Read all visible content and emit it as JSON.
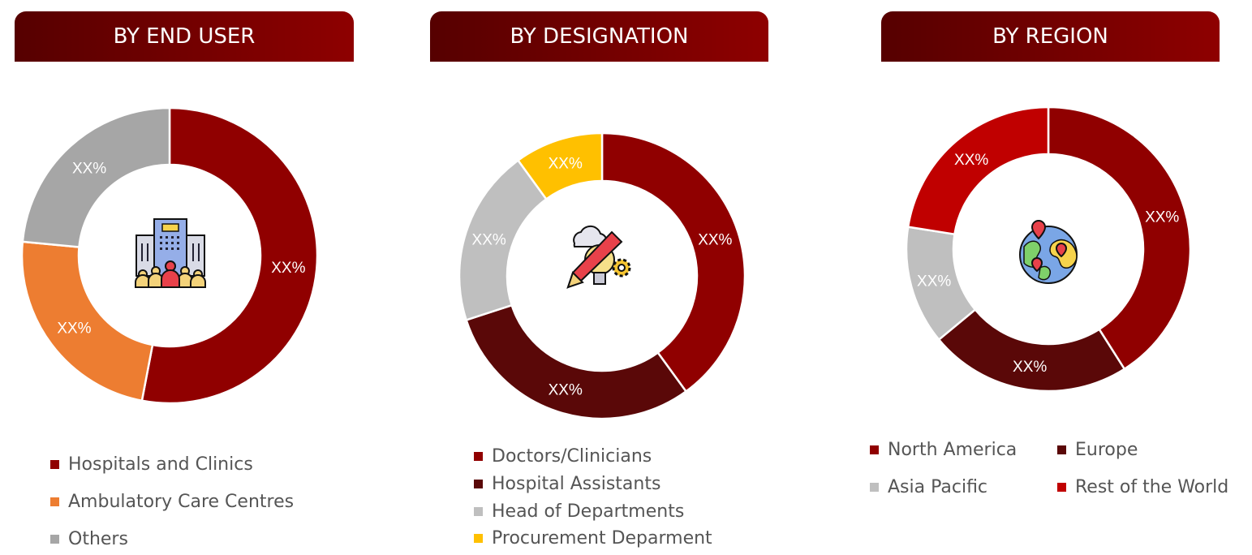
{
  "chart_data": [
    {
      "type": "pie",
      "title": "BY END USER",
      "categories": [
        "Hospitals and Clinics",
        "Ambulatory Care Centres",
        "Others"
      ],
      "values": [
        53,
        23.5,
        23.5
      ],
      "data_labels": [
        "XX%",
        "XX%",
        "XX%"
      ],
      "colors": [
        "#900000",
        "#ed7d31",
        "#a6a6a6"
      ],
      "donut": true,
      "legend": "bottom",
      "center_icon": "hospital-building-people-icon"
    },
    {
      "type": "pie",
      "title": "BY DESIGNATION",
      "categories": [
        "Doctors/Clinicians",
        "Hospital Assistants",
        "Head of Departments",
        "Procurement Deparment"
      ],
      "values": [
        40,
        30,
        20,
        10
      ],
      "data_labels": [
        "XX%",
        "XX%",
        "XX%",
        "XX%"
      ],
      "colors": [
        "#900000",
        "#5a0808",
        "#bfbfbf",
        "#ffc000"
      ],
      "donut": true,
      "legend": "bottom",
      "center_icon": "idea-pencil-gear-icon"
    },
    {
      "type": "pie",
      "title": "BY REGION",
      "categories": [
        "North America",
        "Europe",
        "Asia Pacific",
        "Rest of the World"
      ],
      "values": [
        41,
        23,
        13.5,
        22.5
      ],
      "data_labels": [
        "XX%",
        "XX%",
        "XX%",
        "XX%"
      ],
      "colors": [
        "#900000",
        "#5a0808",
        "#bfbfbf",
        "#c00000"
      ],
      "donut": true,
      "legend": "bottom",
      "center_icon": "globe-location-icon"
    }
  ]
}
